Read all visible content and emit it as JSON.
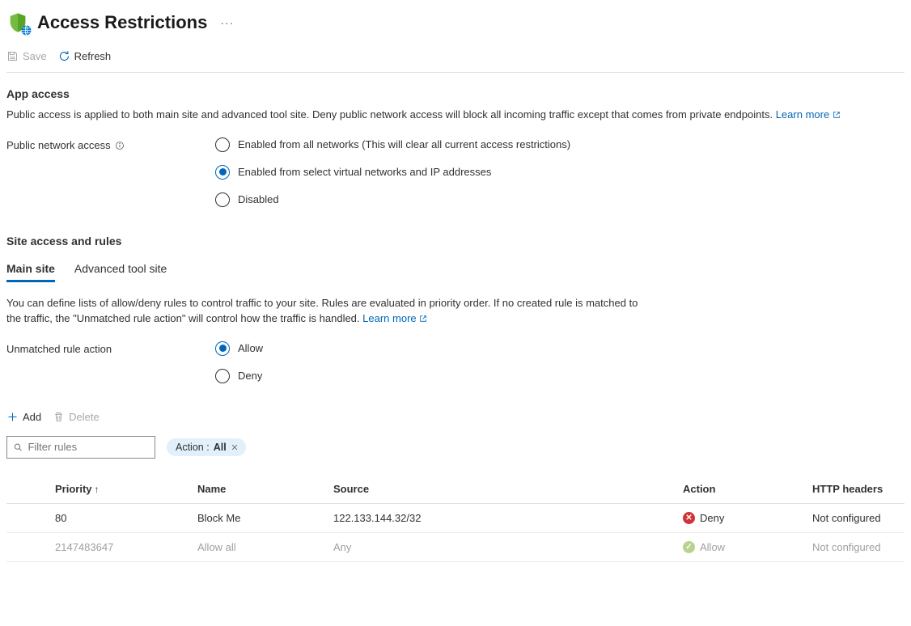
{
  "header": {
    "title": "Access Restrictions"
  },
  "toolbar": {
    "save_label": "Save",
    "refresh_label": "Refresh"
  },
  "app_access": {
    "heading": "App access",
    "description": "Public access is applied to both main site and advanced tool site. Deny public network access will block all incoming traffic except that comes from private endpoints.",
    "learn_more": "Learn more",
    "field_label": "Public network access",
    "options": [
      {
        "label": "Enabled from all networks (This will clear all current access restrictions)",
        "selected": false
      },
      {
        "label": "Enabled from select virtual networks and IP addresses",
        "selected": true
      },
      {
        "label": "Disabled",
        "selected": false
      }
    ]
  },
  "site_access": {
    "heading": "Site access and rules",
    "tabs": [
      {
        "label": "Main site",
        "active": true
      },
      {
        "label": "Advanced tool site",
        "active": false
      }
    ],
    "description": "You can define lists of allow/deny rules to control traffic to your site. Rules are evaluated in priority order. If no created rule is matched to the traffic, the \"Unmatched rule action\" will control how the traffic is handled.",
    "learn_more": "Learn more",
    "unmatched_rule_label": "Unmatched rule action",
    "unmatched_options": [
      {
        "label": "Allow",
        "selected": true
      },
      {
        "label": "Deny",
        "selected": false
      }
    ]
  },
  "actions": {
    "add_label": "Add",
    "delete_label": "Delete"
  },
  "filter": {
    "placeholder": "Filter rules",
    "pill_prefix": "Action : ",
    "pill_value": "All"
  },
  "table": {
    "columns": {
      "priority": "Priority",
      "name": "Name",
      "source": "Source",
      "action": "Action",
      "headers": "HTTP headers"
    },
    "rows": [
      {
        "priority": "80",
        "name": "Block Me",
        "source": "122.133.144.32/32",
        "action": "Deny",
        "headers": "Not configured",
        "muted": false
      },
      {
        "priority": "2147483647",
        "name": "Allow all",
        "source": "Any",
        "action": "Allow",
        "headers": "Not configured",
        "muted": true
      }
    ]
  }
}
